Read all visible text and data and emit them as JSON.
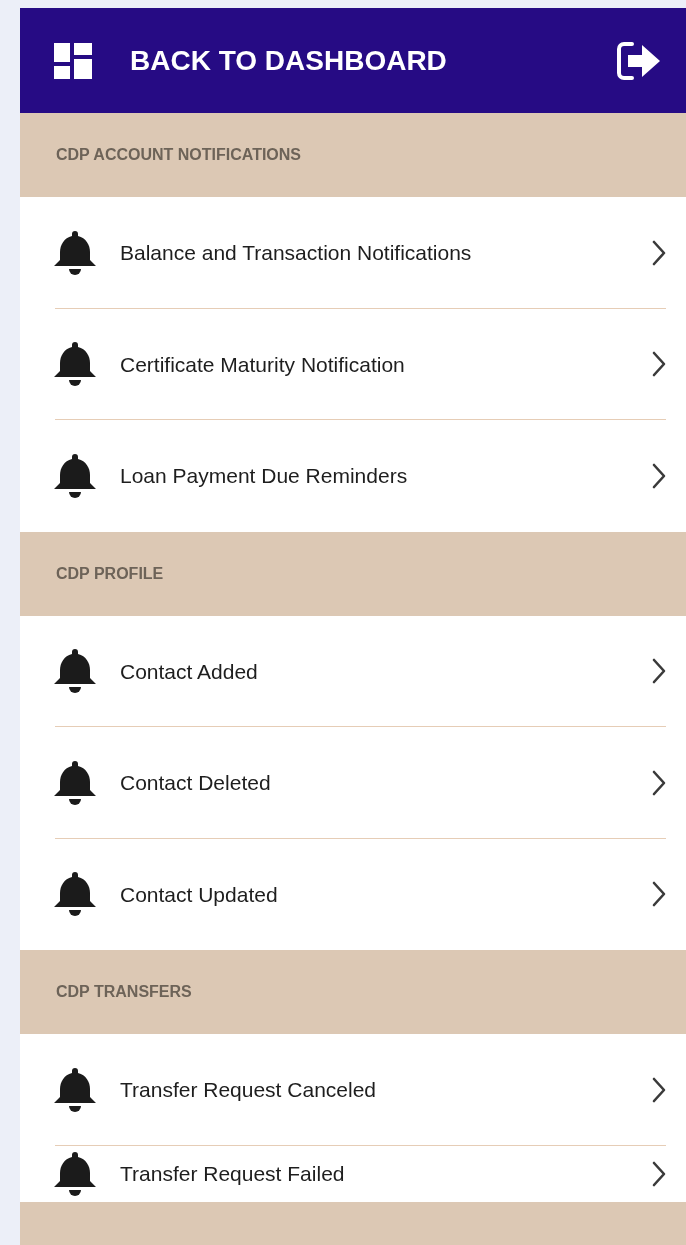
{
  "header": {
    "title": "BACK TO DASHBOARD"
  },
  "sections": [
    {
      "title": "CDP ACCOUNT NOTIFICATIONS",
      "items": [
        {
          "label": "Balance and Transaction Notifications"
        },
        {
          "label": "Certificate Maturity Notification"
        },
        {
          "label": "Loan Payment Due Reminders"
        }
      ]
    },
    {
      "title": "CDP PROFILE",
      "items": [
        {
          "label": "Contact Added"
        },
        {
          "label": "Contact Deleted"
        },
        {
          "label": "Contact Updated"
        }
      ]
    },
    {
      "title": "CDP TRANSFERS",
      "items": [
        {
          "label": "Transfer Request Canceled"
        },
        {
          "label": "Transfer Request Failed"
        }
      ]
    }
  ]
}
